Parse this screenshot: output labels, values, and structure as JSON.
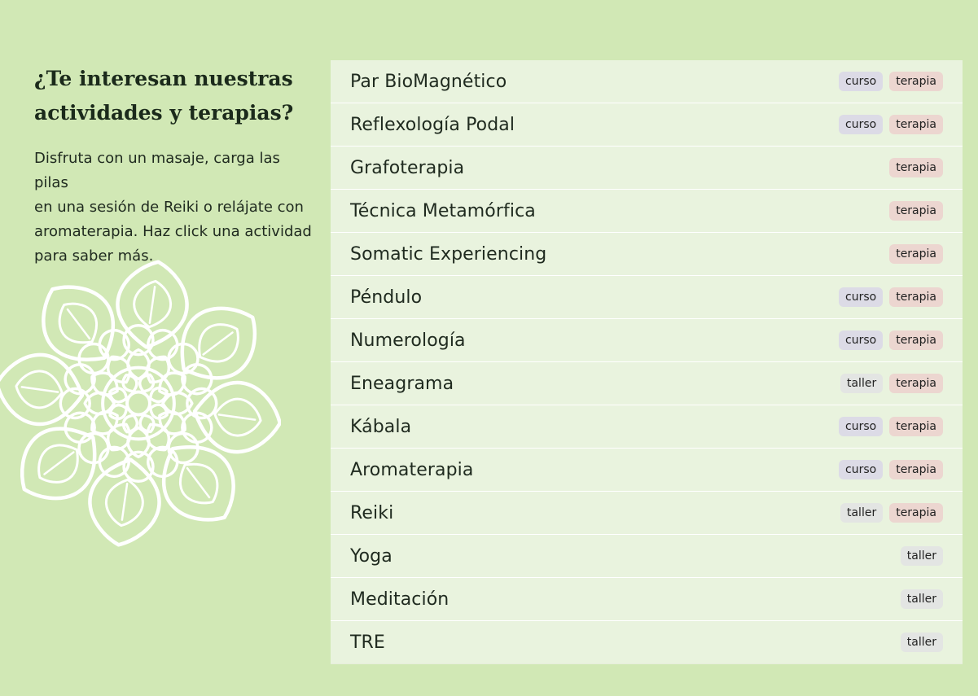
{
  "intro": {
    "title_line1": "¿Te interesan nuestras",
    "title_line2": "actividades y terapias?",
    "desc_line1": "Disfruta con un masaje, carga las pilas",
    "desc_line2": "en una sesión de Reiki o relájate con",
    "desc_line3": "aromaterapia. Haz click una actividad",
    "desc_line4": "para saber más."
  },
  "decoration": {
    "icon": "mandala-icon",
    "color": "#ffffff"
  },
  "activities": [
    {
      "name": "Par BioMagnético",
      "tags": [
        "curso",
        "terapia"
      ]
    },
    {
      "name": "Reflexología Podal",
      "tags": [
        "curso",
        "terapia"
      ]
    },
    {
      "name": "Grafoterapia",
      "tags": [
        "terapia"
      ]
    },
    {
      "name": "Técnica Metamórfica",
      "tags": [
        "terapia"
      ]
    },
    {
      "name": "Somatic Experiencing",
      "tags": [
        "terapia"
      ]
    },
    {
      "name": "Péndulo",
      "tags": [
        "curso",
        "terapia"
      ]
    },
    {
      "name": "Numerología",
      "tags": [
        "curso",
        "terapia"
      ]
    },
    {
      "name": "Eneagrama",
      "tags": [
        "taller",
        "terapia"
      ]
    },
    {
      "name": "Kábala",
      "tags": [
        "curso",
        "terapia"
      ]
    },
    {
      "name": "Aromaterapia",
      "tags": [
        "curso",
        "terapia"
      ]
    },
    {
      "name": "Reiki",
      "tags": [
        "taller",
        "terapia"
      ]
    },
    {
      "name": "Yoga",
      "tags": [
        "taller"
      ]
    },
    {
      "name": "Meditación",
      "tags": [
        "taller"
      ]
    },
    {
      "name": "TRE",
      "tags": [
        "taller"
      ]
    }
  ],
  "colors": {
    "background": "#d1e8b5",
    "curso": "#dcdbe6",
    "terapia": "#ecd6d0",
    "taller": "#e3e5e3"
  }
}
